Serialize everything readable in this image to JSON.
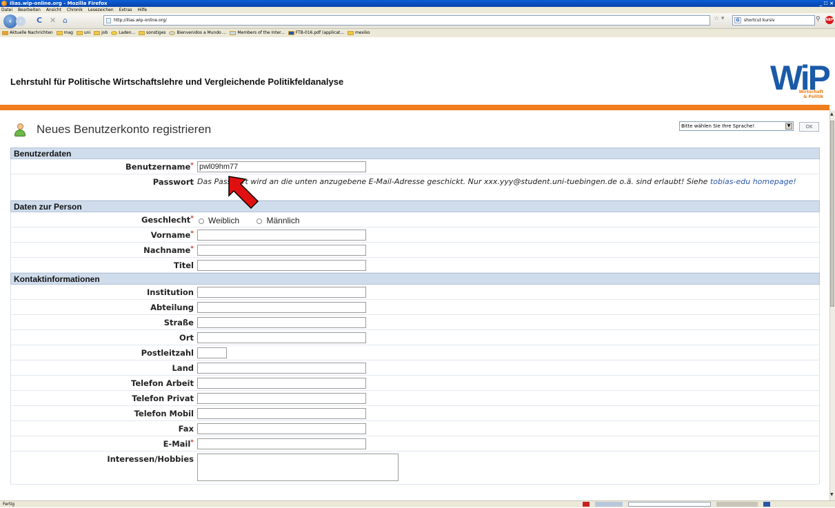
{
  "window": {
    "title": "ilias.wip-online.org - Mozilla Firefox",
    "controls": "_ ☐ ×"
  },
  "menu": [
    "Datei",
    "Bearbeiten",
    "Ansicht",
    "Chronik",
    "Lesezeichen",
    "Extras",
    "Hilfe"
  ],
  "nav": {
    "url": "http://ilias.wip-online.org/",
    "search_value": "shortcut kursiv"
  },
  "bookmarks": [
    "Aktuelle Nachrichten",
    "mag",
    "uni",
    "job",
    "Laden...",
    "sonstiges",
    "Bienvenidos a Mundo ...",
    "Members of the Inter...",
    "FTB-016.pdf (applicat...",
    "mexiko"
  ],
  "header": {
    "title": "Lehrstuhl für Politische Wirtschaftslehre und Vergleichende Politikfeldanalyse",
    "logo_text": "WiP",
    "logo_sub1": "Wirtschaft",
    "logo_sub2": "& Politik"
  },
  "page": {
    "title": "Neues Benutzerkonto registrieren",
    "language_select": "Bitte wählen Sie Ihre Sprache!",
    "ok_label": "OK"
  },
  "form": {
    "sections": {
      "benutzerdaten": "Benutzerdaten",
      "person": "Daten zur Person",
      "kontakt": "Kontaktinformationen"
    },
    "benutzername": {
      "label": "Benutzername",
      "value": "pwl09hm77"
    },
    "passwort": {
      "label": "Passwort",
      "text": "Das Passwort wird an die unten anzugebene E-Mail-Adresse geschickt. Nur xxx.yyy@student.uni-tuebingen.de o.ä. sind erlaubt! Siehe ",
      "link": "tobias-edu homepage!"
    },
    "geschlecht": {
      "label": "Geschlecht",
      "options": [
        "Weiblich",
        "Männlich"
      ]
    },
    "vorname": {
      "label": "Vorname"
    },
    "nachname": {
      "label": "Nachname"
    },
    "titel": {
      "label": "Titel"
    },
    "institution": {
      "label": "Institution"
    },
    "abteilung": {
      "label": "Abteilung"
    },
    "strasse": {
      "label": "Straße"
    },
    "ort": {
      "label": "Ort"
    },
    "plz": {
      "label": "Postleitzahl"
    },
    "land": {
      "label": "Land"
    },
    "tel_arbeit": {
      "label": "Telefon Arbeit"
    },
    "tel_privat": {
      "label": "Telefon Privat"
    },
    "tel_mobil": {
      "label": "Telefon Mobil"
    },
    "fax": {
      "label": "Fax"
    },
    "email": {
      "label": "E-Mail"
    },
    "hobbies": {
      "label": "Interessen/Hobbies"
    },
    "required_mark": "*"
  },
  "status": {
    "text": "Fertig"
  },
  "colors": {
    "accent_orange": "#f07d1e",
    "logo_blue": "#1a5aa8",
    "section_bg": "#cfdcec",
    "annotation_arrow": "#e01010"
  }
}
